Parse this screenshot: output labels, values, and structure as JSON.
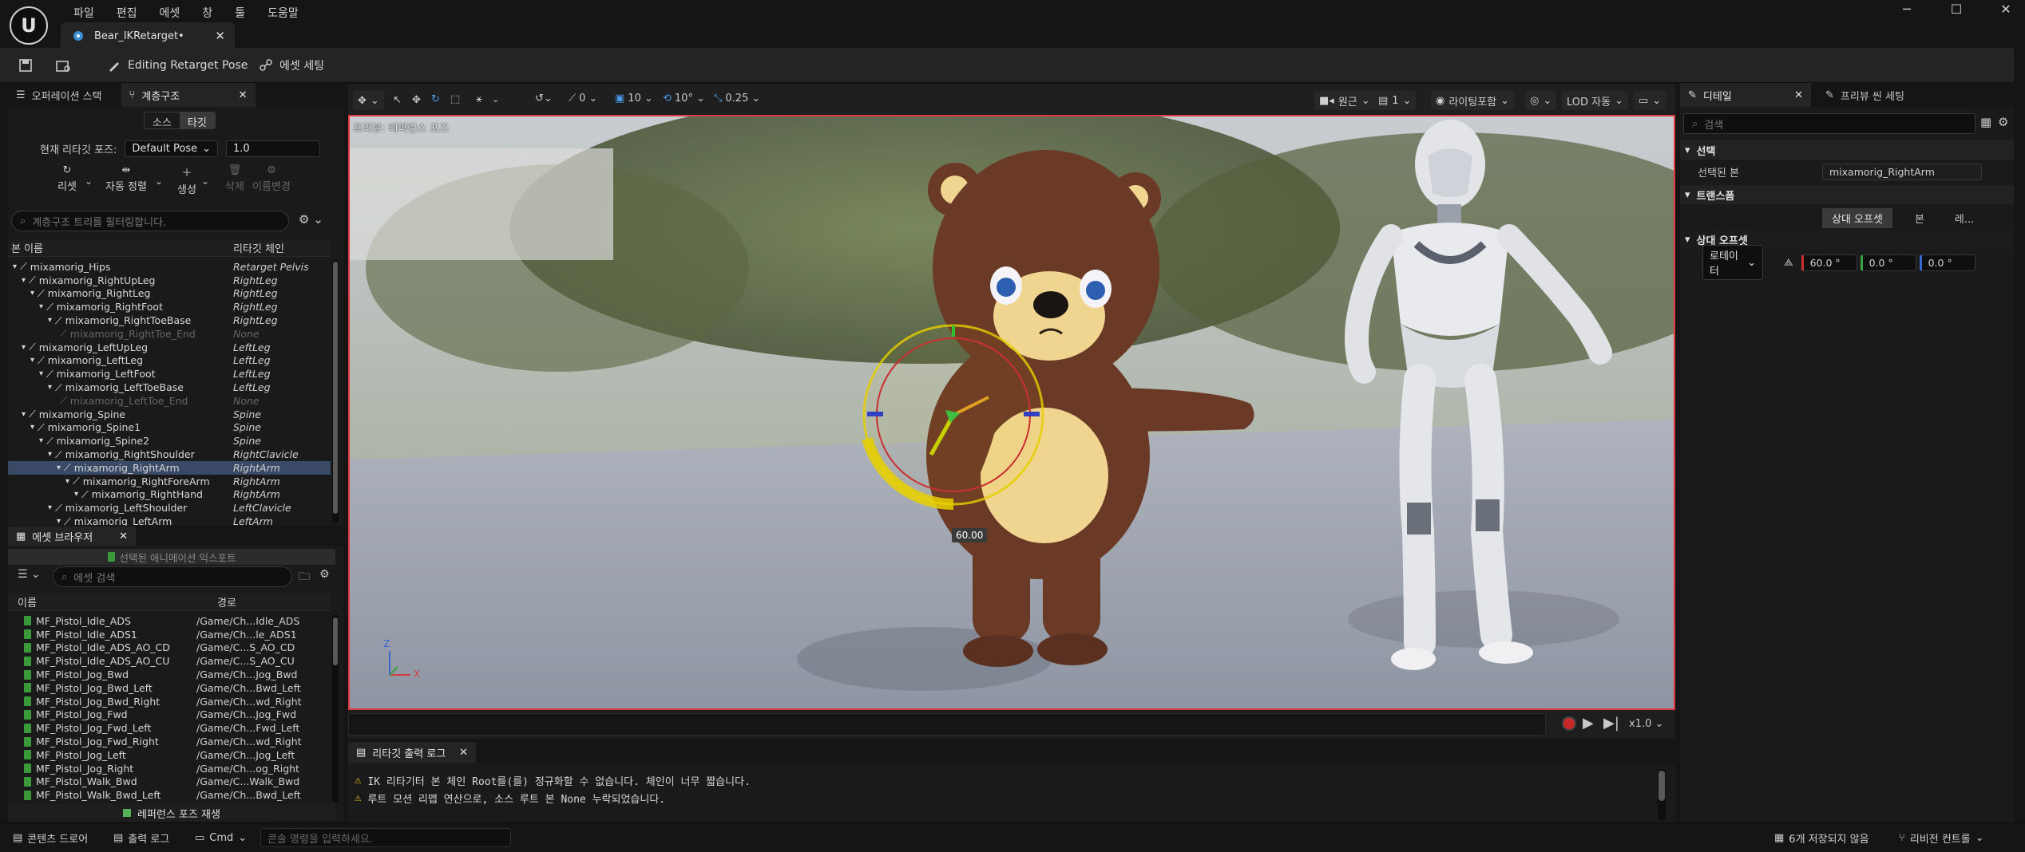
{
  "app": {
    "logo": "U"
  },
  "menu": [
    "파일",
    "편집",
    "에셋",
    "창",
    "툴",
    "도움말"
  ],
  "asset_tab": {
    "title": "Bear_IKRetarget•"
  },
  "toolbar": {
    "editing_pose": "Editing Retarget Pose",
    "asset_settings": "에셋 세팅"
  },
  "left_panel": {
    "tabs": [
      "오퍼레이션 스택",
      "계층구조"
    ],
    "segment": [
      "소스",
      "타깃"
    ],
    "pose_label": "현재 리타깃 포즈:",
    "pose_value": "Default Pose",
    "pose_blend": "1.0",
    "tools": [
      "리셋",
      "자동 정렬",
      "생성",
      "삭제",
      "이름변경"
    ],
    "filter_placeholder": "계층구조 트리를 필터링합니다.",
    "columns": [
      "본 이름",
      "리타깃 체인"
    ],
    "bones": [
      {
        "name": "mixamorig_Hips",
        "chain": "Retarget Pelvis",
        "depth": 0
      },
      {
        "name": "mixamorig_RightUpLeg",
        "chain": "RightLeg",
        "depth": 1
      },
      {
        "name": "mixamorig_RightLeg",
        "chain": "RightLeg",
        "depth": 2
      },
      {
        "name": "mixamorig_RightFoot",
        "chain": "RightLeg",
        "depth": 3
      },
      {
        "name": "mixamorig_RightToeBase",
        "chain": "RightLeg",
        "depth": 4
      },
      {
        "name": "mixamorig_RightToe_End",
        "chain": "None",
        "depth": 5,
        "muted": true
      },
      {
        "name": "mixamorig_LeftUpLeg",
        "chain": "LeftLeg",
        "depth": 1
      },
      {
        "name": "mixamorig_LeftLeg",
        "chain": "LeftLeg",
        "depth": 2
      },
      {
        "name": "mixamorig_LeftFoot",
        "chain": "LeftLeg",
        "depth": 3
      },
      {
        "name": "mixamorig_LeftToeBase",
        "chain": "LeftLeg",
        "depth": 4
      },
      {
        "name": "mixamorig_LeftToe_End",
        "chain": "None",
        "depth": 5,
        "muted": true
      },
      {
        "name": "mixamorig_Spine",
        "chain": "Spine",
        "depth": 1
      },
      {
        "name": "mixamorig_Spine1",
        "chain": "Spine",
        "depth": 2
      },
      {
        "name": "mixamorig_Spine2",
        "chain": "Spine",
        "depth": 3
      },
      {
        "name": "mixamorig_RightShoulder",
        "chain": "RightClavicle",
        "depth": 4
      },
      {
        "name": "mixamorig_RightArm",
        "chain": "RightArm",
        "depth": 5,
        "selected": true
      },
      {
        "name": "mixamorig_RightForeArm",
        "chain": "RightArm",
        "depth": 6
      },
      {
        "name": "mixamorig_RightHand",
        "chain": "RightArm",
        "depth": 7
      },
      {
        "name": "mixamorig_LeftShoulder",
        "chain": "LeftClavicle",
        "depth": 4
      },
      {
        "name": "mixamorig_LeftArm",
        "chain": "LeftArm",
        "depth": 5
      }
    ]
  },
  "asset_browser": {
    "tab": "에셋 브라우저",
    "filter_label": "선택된 애니메이션 익스포트",
    "search_placeholder": "에셋 검색",
    "columns": [
      "이름",
      "경로"
    ],
    "assets": [
      {
        "name": "MF_Pistol_Idle_ADS",
        "path": "/Game/Ch...Idle_ADS"
      },
      {
        "name": "MF_Pistol_Idle_ADS1",
        "path": "/Game/Ch...le_ADS1"
      },
      {
        "name": "MF_Pistol_Idle_ADS_AO_CD",
        "path": "/Game/C...S_AO_CD"
      },
      {
        "name": "MF_Pistol_Idle_ADS_AO_CU",
        "path": "/Game/C...S_AO_CU"
      },
      {
        "name": "MF_Pistol_Jog_Bwd",
        "path": "/Game/Ch...Jog_Bwd"
      },
      {
        "name": "MF_Pistol_Jog_Bwd_Left",
        "path": "/Game/Ch...Bwd_Left"
      },
      {
        "name": "MF_Pistol_Jog_Bwd_Right",
        "path": "/Game/Ch...wd_Right"
      },
      {
        "name": "MF_Pistol_Jog_Fwd",
        "path": "/Game/Ch...Jog_Fwd"
      },
      {
        "name": "MF_Pistol_Jog_Fwd_Left",
        "path": "/Game/Ch...Fwd_Left"
      },
      {
        "name": "MF_Pistol_Jog_Fwd_Right",
        "path": "/Game/Ch...wd_Right"
      },
      {
        "name": "MF_Pistol_Jog_Left",
        "path": "/Game/Ch...Jog_Left"
      },
      {
        "name": "MF_Pistol_Jog_Right",
        "path": "/Game/Ch...og_Right"
      },
      {
        "name": "MF_Pistol_Walk_Bwd",
        "path": "/Game/C...Walk_Bwd"
      },
      {
        "name": "MF_Pistol_Walk_Bwd_Left",
        "path": "/Game/Ch...Bwd_Left"
      }
    ],
    "play_ref": "레퍼런스 포즈 재생"
  },
  "viewport": {
    "preview_label": "프리뷰: 레퍼런스 포즈",
    "snap_angle": "0",
    "grid_size": "10",
    "rot_snap": "10°",
    "scale_snap": "0.25",
    "projection": "원근",
    "view_count": "1",
    "lighting": "라이팅포함",
    "lod": "LOD 자동",
    "gizmo_value": "60.00",
    "axis_z": "Z",
    "axis_x": "X",
    "play_rate": "x1.0"
  },
  "details": {
    "tabs": [
      "디테일",
      "프리뷰 씬 세팅"
    ],
    "search_placeholder": "검색",
    "section_selection": "선택",
    "selected_bone_label": "선택된 본",
    "selected_bone_value": "mixamorig_RightArm",
    "section_transform": "트랜스폼",
    "space_buttons": [
      "상대 오프셋",
      "본",
      "레..."
    ],
    "section_offset": "상대 오프셋",
    "rotator_label": "로테이터",
    "rot_values": [
      "60.0 °",
      "0.0 °",
      "0.0 °"
    ]
  },
  "output_log": {
    "tab": "리타깃 출력 로그",
    "lines": [
      "IK 리타기터 본 체인 Root를(를) 정규화할 수 없습니다. 체인이 너무 짧습니다.",
      "루트 모션 리맵 연산으로, 소스 루트 본 None 누락되었습니다."
    ]
  },
  "status_bar": {
    "content_drawer": "콘텐츠 드로어",
    "output_log": "출력 로그",
    "cmd": "Cmd",
    "cmd_placeholder": "콘솔 명령을 입력하세요.",
    "unsaved": "6개 저장되지 않음",
    "revision": "리비전 컨트롤"
  },
  "colors": {
    "selection": "#3a4a66",
    "viewport_border": "#e23a44",
    "gizmo": "#e8d000"
  }
}
